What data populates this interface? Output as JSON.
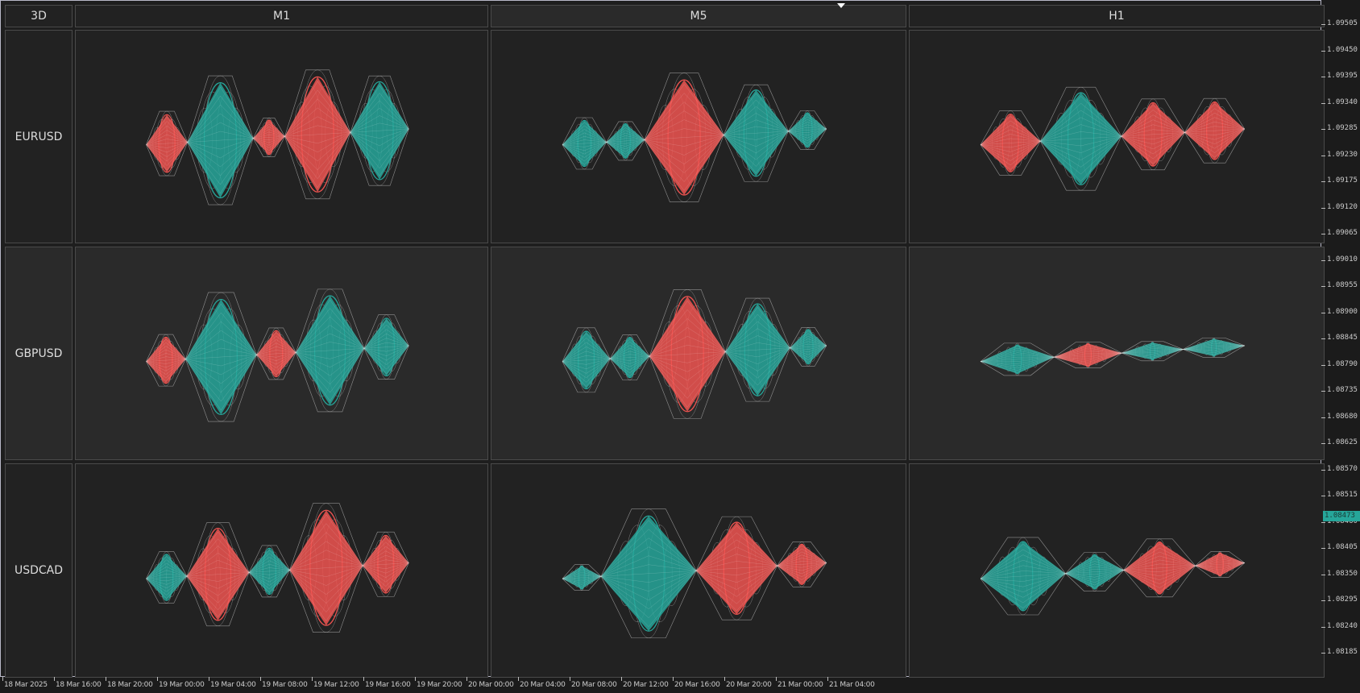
{
  "corner_label": "3D",
  "columns": [
    "M1",
    "M5",
    "H1"
  ],
  "rows": [
    "EURUSD",
    "GBPUSD",
    "USDCAD"
  ],
  "colors": {
    "bull": "#26a69a",
    "bear": "#ef5350",
    "wire": "#bdbdbd"
  },
  "cells": [
    [
      [
        [
          "bear",
          0.5
        ],
        [
          "bull",
          1.0
        ],
        [
          "bear",
          0.3
        ],
        [
          "bear",
          1.0
        ],
        [
          "bull",
          0.85
        ]
      ],
      [
        [
          "bull",
          0.4
        ],
        [
          "bull",
          0.3
        ],
        [
          "bear",
          1.0
        ],
        [
          "bull",
          0.75
        ],
        [
          "bull",
          0.3
        ]
      ],
      [
        [
          "bear",
          0.5
        ],
        [
          "bull",
          0.8
        ],
        [
          "bear",
          0.55
        ],
        [
          "bear",
          0.5
        ]
      ]
    ],
    [
      [
        [
          "bear",
          0.4
        ],
        [
          "bull",
          1.0
        ],
        [
          "bear",
          0.4
        ],
        [
          "bull",
          0.95
        ],
        [
          "bull",
          0.5
        ]
      ],
      [
        [
          "bull",
          0.5
        ],
        [
          "bull",
          0.35
        ],
        [
          "bear",
          1.0
        ],
        [
          "bull",
          0.8
        ],
        [
          "bull",
          0.3
        ]
      ],
      [
        [
          "bull",
          0.25
        ],
        [
          "bear",
          0.2
        ],
        [
          "bull",
          0.15
        ],
        [
          "bull",
          0.15
        ]
      ]
    ],
    [
      [
        [
          "bull",
          0.4
        ],
        [
          "bear",
          0.8
        ],
        [
          "bull",
          0.4
        ],
        [
          "bear",
          1.0
        ],
        [
          "bear",
          0.5
        ]
      ],
      [
        [
          "bull",
          0.2
        ],
        [
          "bull",
          1.0
        ],
        [
          "bear",
          0.8
        ],
        [
          "bear",
          0.35
        ]
      ],
      [
        [
          "bull",
          0.6
        ],
        [
          "bull",
          0.3
        ],
        [
          "bear",
          0.45
        ],
        [
          "bear",
          0.2
        ]
      ]
    ]
  ],
  "price_axis": {
    "labels": [
      "1.09505",
      "1.09450",
      "1.09395",
      "1.09340",
      "1.09285",
      "1.09230",
      "1.09175",
      "1.09120",
      "1.09065",
      "1.09010",
      "1.08955",
      "1.08900",
      "1.08845",
      "1.08790",
      "1.08735",
      "1.08680",
      "1.08625",
      "1.08570",
      "1.08515",
      "1.08460",
      "1.08405",
      "1.08350",
      "1.08295",
      "1.08240",
      "1.08185"
    ],
    "current_price": "1.08473"
  },
  "time_axis": [
    "18 Mar 2025",
    "18 Mar 16:00",
    "18 Mar 20:00",
    "19 Mar 00:00",
    "19 Mar 04:00",
    "19 Mar 08:00",
    "19 Mar 12:00",
    "19 Mar 16:00",
    "19 Mar 20:00",
    "20 Mar 00:00",
    "20 Mar 04:00",
    "20 Mar 08:00",
    "20 Mar 12:00",
    "20 Mar 16:00",
    "20 Mar 20:00",
    "21 Mar 00:00",
    "21 Mar 04:00"
  ]
}
